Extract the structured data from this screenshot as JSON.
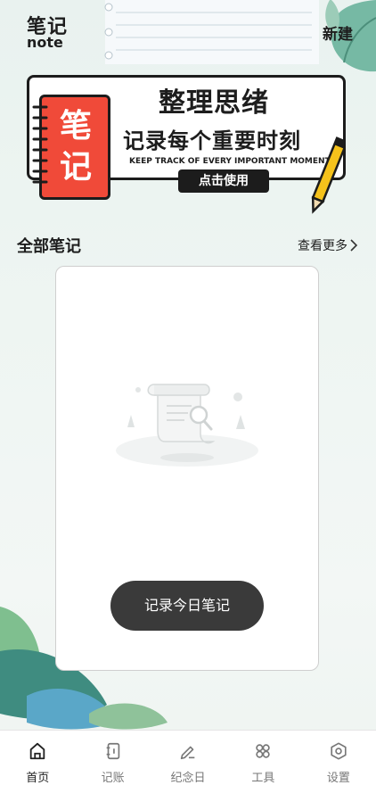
{
  "header": {
    "logo_cn": "笔记",
    "logo_en": "note",
    "new_label": "新建"
  },
  "banner": {
    "title": "整理思绪",
    "subtitle": "记录每个重要时刻",
    "tagline": "KEEP TRACK OF EVERY IMPORTANT MOMENT",
    "cta": "点击使用",
    "book_chars": [
      "笔",
      "记"
    ]
  },
  "section": {
    "title": "全部笔记",
    "more_label": "查看更多"
  },
  "empty_card": {
    "button_label": "记录今日笔记"
  },
  "tabs": [
    {
      "label": "首页",
      "icon": "home-icon",
      "active": true
    },
    {
      "label": "记账",
      "icon": "ledger-icon",
      "active": false
    },
    {
      "label": "纪念日",
      "icon": "pen-icon",
      "active": false
    },
    {
      "label": "工具",
      "icon": "grid-icon",
      "active": false
    },
    {
      "label": "设置",
      "icon": "settings-icon",
      "active": false
    }
  ],
  "colors": {
    "accent_red": "#f04a39",
    "pencil_yellow": "#f5c21b",
    "dark": "#1c1c1c",
    "leaf_green": "#6fb39a",
    "leaf_blue": "#5aa7c8"
  }
}
